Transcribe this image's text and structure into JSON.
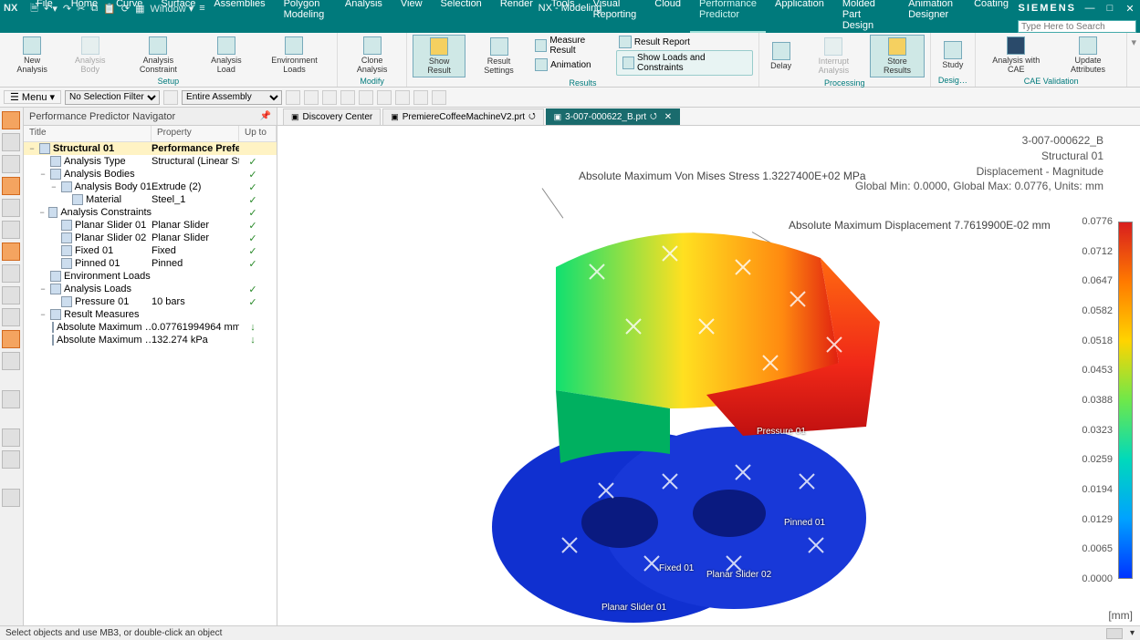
{
  "app": {
    "title": "NX - Modeling",
    "brand": "SIEMENS",
    "logo": "NX"
  },
  "qat": {
    "window_label": "Window"
  },
  "menu": {
    "tabs": [
      "File",
      "Home",
      "Curve",
      "Surface",
      "Assemblies",
      "Polygon Modeling",
      "Analysis",
      "View",
      "Selection",
      "Render",
      "Tools",
      "Visual Reporting",
      "Cloud",
      "Performance Predictor",
      "Application",
      "Molded Part Design",
      "Animation Designer",
      "Coating"
    ],
    "active_index": 13,
    "search_placeholder": "Type Here to Search"
  },
  "ribbon": {
    "setup": {
      "label": "Setup",
      "new_analysis": "New\nAnalysis",
      "analysis_body": "Analysis\nBody",
      "analysis_constraint": "Analysis\nConstraint",
      "analysis_load": "Analysis\nLoad",
      "env_loads": "Environment\nLoads"
    },
    "modify": {
      "label": "Modify",
      "clone": "Clone\nAnalysis"
    },
    "results": {
      "label": "Results",
      "show_result": "Show\nResult",
      "result_settings": "Result\nSettings",
      "measure_result": "Measure Result",
      "result_report": "Result Report",
      "animation": "Animation",
      "show_loads": "Show Loads and Constraints"
    },
    "processing": {
      "label": "Processing",
      "delay": "Delay",
      "interrupt": "Interrupt\nAnalysis",
      "store": "Store\nResults"
    },
    "design": {
      "label": "Desig…",
      "study": "Study"
    },
    "cae": {
      "label": "CAE Validation",
      "with_cae": "Analysis\nwith CAE",
      "update_attrs": "Update\nAttributes"
    }
  },
  "toolbar2": {
    "menu": "Menu",
    "selfilter": "No Selection Filter",
    "assembly": "Entire Assembly"
  },
  "nav": {
    "title": "Performance Predictor Navigator",
    "cols": {
      "c1": "Title",
      "c2": "Property",
      "c3": "Up to"
    },
    "rows": [
      {
        "ind": 0,
        "exp": "−",
        "icon": 1,
        "t": "Structural 01",
        "p": "Performance Preferred",
        "s": "",
        "bold": 1,
        "hl": 1
      },
      {
        "ind": 1,
        "exp": "",
        "icon": 1,
        "t": "Analysis Type",
        "p": "Structural (Linear Statics)",
        "s": "✓"
      },
      {
        "ind": 1,
        "exp": "−",
        "icon": 1,
        "t": "Analysis Bodies",
        "p": "",
        "s": "✓"
      },
      {
        "ind": 2,
        "exp": "−",
        "icon": 1,
        "t": "Analysis Body 01",
        "p": "Extrude (2)",
        "s": "✓"
      },
      {
        "ind": 3,
        "exp": "",
        "icon": 1,
        "t": "Material",
        "p": "Steel_1",
        "s": "✓"
      },
      {
        "ind": 1,
        "exp": "−",
        "icon": 1,
        "t": "Analysis Constraints",
        "p": "",
        "s": "✓"
      },
      {
        "ind": 2,
        "exp": "",
        "icon": 1,
        "t": "Planar Slider 01",
        "p": "Planar Slider",
        "s": "✓"
      },
      {
        "ind": 2,
        "exp": "",
        "icon": 1,
        "t": "Planar Slider 02",
        "p": "Planar Slider",
        "s": "✓"
      },
      {
        "ind": 2,
        "exp": "",
        "icon": 1,
        "t": "Fixed 01",
        "p": "Fixed",
        "s": "✓"
      },
      {
        "ind": 2,
        "exp": "",
        "icon": 1,
        "t": "Pinned 01",
        "p": "Pinned",
        "s": "✓"
      },
      {
        "ind": 1,
        "exp": "",
        "icon": 1,
        "t": "Environment Loads",
        "p": "",
        "s": ""
      },
      {
        "ind": 1,
        "exp": "−",
        "icon": 1,
        "t": "Analysis Loads",
        "p": "",
        "s": "✓"
      },
      {
        "ind": 2,
        "exp": "",
        "icon": 1,
        "t": "Pressure 01",
        "p": "10 bars",
        "s": "✓"
      },
      {
        "ind": 1,
        "exp": "−",
        "icon": 1,
        "t": "Result Measures",
        "p": "",
        "s": ""
      },
      {
        "ind": 2,
        "exp": "",
        "icon": 1,
        "t": "Absolute Maximum …",
        "p": "0.07761994964 mm",
        "s": "↓"
      },
      {
        "ind": 2,
        "exp": "",
        "icon": 1,
        "t": "Absolute Maximum …",
        "p": "132.274 kPa",
        "s": "↓"
      }
    ]
  },
  "docs": {
    "tabs": [
      {
        "label": "Discovery Center",
        "active": false
      },
      {
        "label": "PremiereCoffeeMachineV2.prt",
        "active": false,
        "dirty": true
      },
      {
        "label": "3-007-000622_B.prt",
        "active": true,
        "dirty": true,
        "closable": true
      }
    ]
  },
  "viewport": {
    "info": [
      "3-007-000622_B",
      "Structural 01",
      "Displacement - Magnitude",
      "Global Min: 0.0000, Global Max: 0.0776, Units: mm"
    ],
    "annot1": "Absolute Maximum Von Mises Stress 1.3227400E+02 MPa",
    "annot2": "Absolute Maximum Displacement 7.7619900E-02 mm",
    "labels3d": {
      "pinned": "Pinned 01",
      "planar1": "Planar Slider 01",
      "planar2": "Planar Slider 02",
      "pressure": "Pressure 01",
      "fixed": "Fixed 01"
    }
  },
  "legend": {
    "ticks": [
      "0.0776",
      "0.0712",
      "0.0647",
      "0.0582",
      "0.0518",
      "0.0453",
      "0.0388",
      "0.0323",
      "0.0259",
      "0.0194",
      "0.0129",
      "0.0065",
      "0.0000"
    ],
    "unit": "[mm]"
  },
  "status": {
    "text": "Select objects and use MB3, or double-click an object"
  }
}
